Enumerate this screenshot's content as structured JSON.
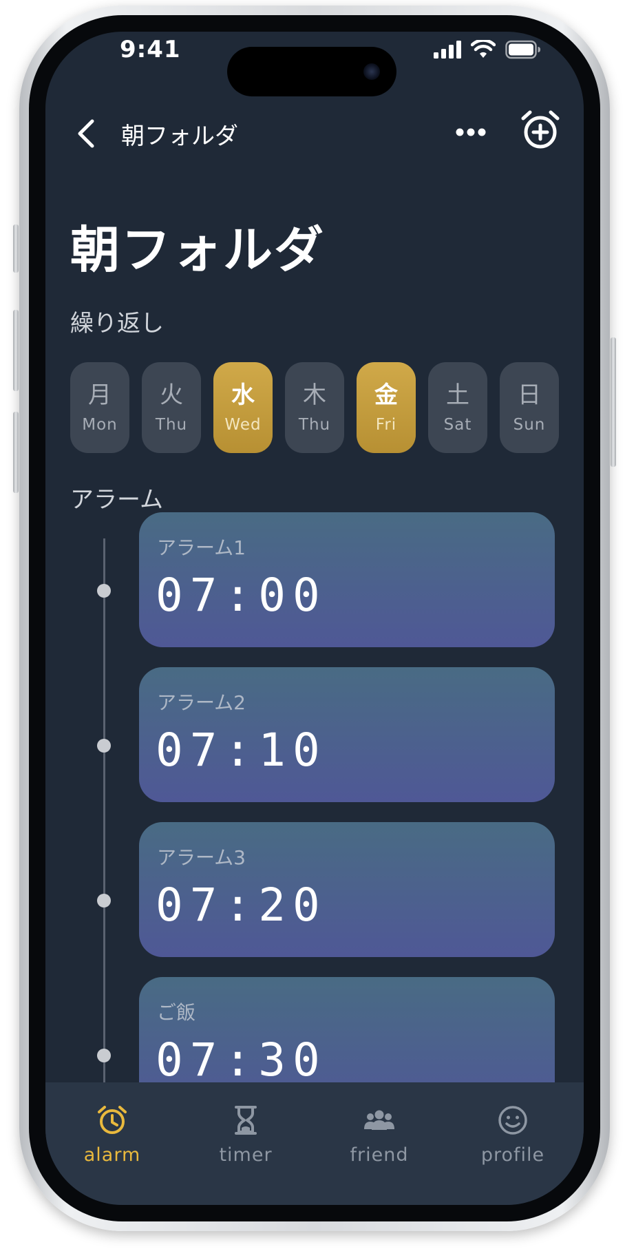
{
  "status_bar": {
    "time": "9:41"
  },
  "nav": {
    "title": "朝フォルダ"
  },
  "page": {
    "title": "朝フォルダ"
  },
  "repeat": {
    "label": "繰り返し",
    "days": [
      {
        "kanji": "月",
        "label": "Mon",
        "selected": false
      },
      {
        "kanji": "火",
        "label": "Thu",
        "selected": false
      },
      {
        "kanji": "水",
        "label": "Wed",
        "selected": true
      },
      {
        "kanji": "木",
        "label": "Thu",
        "selected": false
      },
      {
        "kanji": "金",
        "label": "Fri",
        "selected": true
      },
      {
        "kanji": "土",
        "label": "Sat",
        "selected": false
      },
      {
        "kanji": "日",
        "label": "Sun",
        "selected": false
      }
    ]
  },
  "alarms": {
    "label": "アラーム",
    "items": [
      {
        "name": "アラーム1",
        "time": "07:00"
      },
      {
        "name": "アラーム2",
        "time": "07:10"
      },
      {
        "name": "アラーム3",
        "time": "07:20"
      },
      {
        "name": "ご飯",
        "time": "07:30"
      }
    ]
  },
  "tab_bar": {
    "tabs": [
      {
        "label": "alarm",
        "icon": "alarm-clock-icon",
        "active": true
      },
      {
        "label": "timer",
        "icon": "hourglass-icon",
        "active": false
      },
      {
        "label": "friend",
        "icon": "people-icon",
        "active": false
      },
      {
        "label": "profile",
        "icon": "smiley-icon",
        "active": false
      }
    ]
  },
  "colors": {
    "background": "#1f2937",
    "accent_gold": "#c9a241",
    "day_chip": "#3d4653",
    "card_top": "#496b84",
    "card_bottom": "#4f5896",
    "tab_bar": "#2a3646",
    "active_tab": "#e9b93d"
  }
}
